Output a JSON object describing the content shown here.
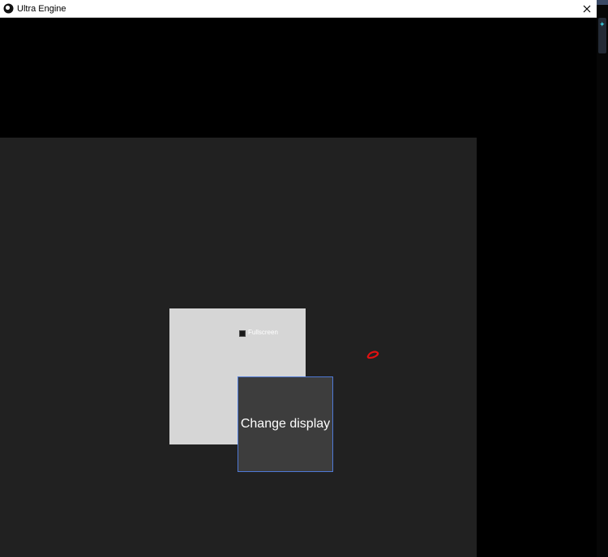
{
  "window": {
    "title": "Ultra Engine"
  },
  "panel": {
    "checkbox_label": "Fullscreen",
    "checkbox_checked": false,
    "button_label": "Change display"
  },
  "colors": {
    "viewport_bg": "#212121",
    "panel_bg": "#d6d6d6",
    "button_bg": "#3d3d3d",
    "button_border": "#4f79d6",
    "cursor_mark": "#e01010"
  },
  "icons": {
    "app": "ultra-engine-logo-icon",
    "close": "close-icon",
    "marker": "red-cursor-mark"
  }
}
